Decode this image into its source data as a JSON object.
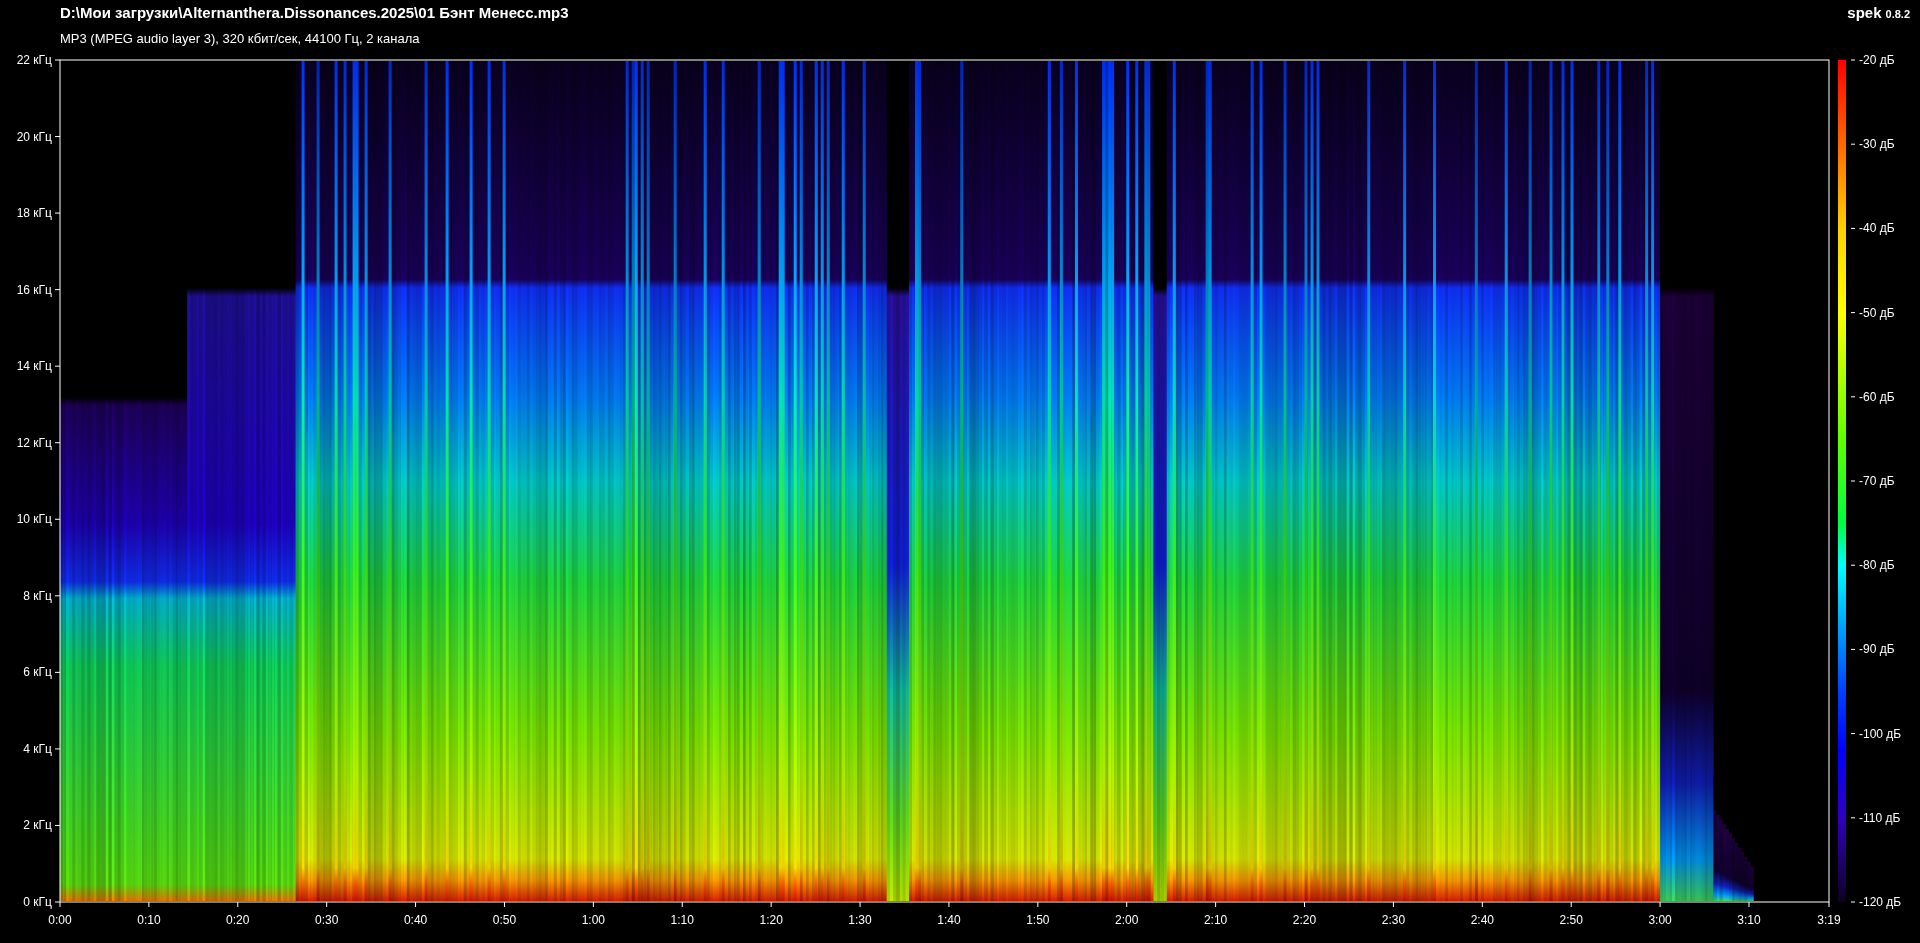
{
  "header": {
    "file_path": "D:\\Мои загрузки\\Alternanthera.Dissonances.2025\\01 Бэнт Менесс.mp3",
    "stream_info": "MP3 (MPEG audio layer 3), 320 кбит/сек, 44100 Гц, 2 канала",
    "app_name": "spek",
    "version": "0.8.2"
  },
  "frequency_axis": [
    "22 кГц",
    "20 кГц",
    "18 кГц",
    "16 кГц",
    "14 кГц",
    "12 кГц",
    "10 кГц",
    "8 кГц",
    "6 кГц",
    "4 кГц",
    "2 кГц",
    "0 кГц"
  ],
  "time_axis": [
    "0:00",
    "0:10",
    "0:20",
    "0:30",
    "0:40",
    "0:50",
    "1:00",
    "1:10",
    "1:20",
    "1:30",
    "1:40",
    "1:50",
    "2:00",
    "2:10",
    "2:20",
    "2:30",
    "2:40",
    "2:50",
    "3:00",
    "3:10",
    "3:19"
  ],
  "level_legend": [
    "-20 дБ",
    "-30 дБ",
    "-40 дБ",
    "-50 дБ",
    "-60 дБ",
    "-70 дБ",
    "-80 дБ",
    "-90 дБ",
    "-100 дБ",
    "-110 дБ",
    "-120 дБ"
  ]
}
